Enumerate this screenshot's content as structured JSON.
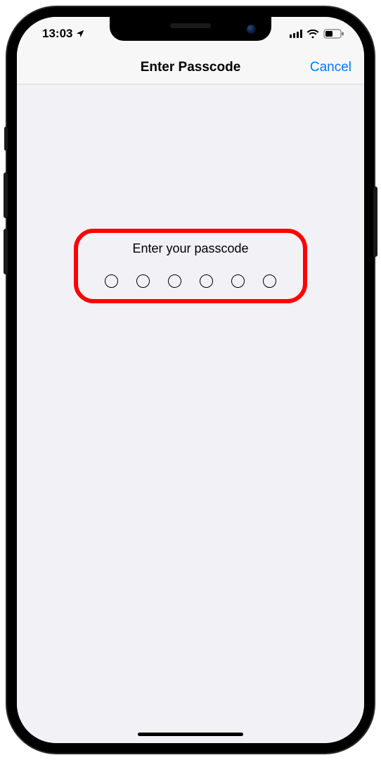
{
  "statusBar": {
    "time": "13:03"
  },
  "navBar": {
    "title": "Enter Passcode",
    "cancel": "Cancel"
  },
  "passcode": {
    "prompt": "Enter your passcode",
    "digitCount": 6
  },
  "colors": {
    "accent": "#007aff",
    "highlight": "#ff0000",
    "background": "#f2f1f6"
  }
}
